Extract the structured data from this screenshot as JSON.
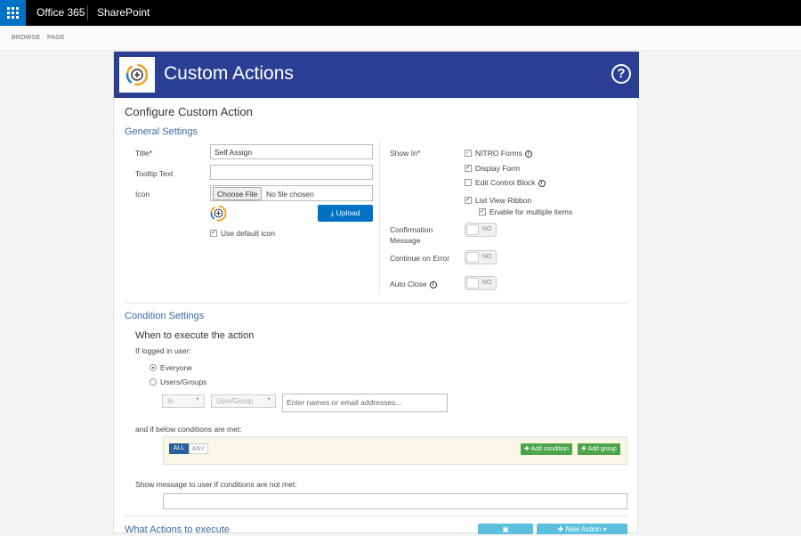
{
  "topbar": {
    "brand": "Office 365",
    "site": "SharePoint"
  },
  "ribbon": {
    "tabs": [
      "BROWSE",
      "PAGE"
    ]
  },
  "header": {
    "title": "Custom Actions",
    "help": "?"
  },
  "configure": {
    "title": "Configure Custom Action"
  },
  "general": {
    "heading": "General Settings",
    "title_label": "Title",
    "req": "*",
    "title_value": "Self Assign",
    "tooltip_label": "Tooltip Text",
    "tooltip_value": "",
    "icon_label": "Icon",
    "choose_file": "Choose File",
    "no_file": "No file chosen",
    "upload": "Upload",
    "use_default": "Use default icon"
  },
  "showin": {
    "label": "Show In",
    "req": "*",
    "options": [
      {
        "label": "NITRO Forms",
        "checked": true,
        "info": true
      },
      {
        "label": "Display Form",
        "checked": true,
        "info": false
      },
      {
        "label": "Edit Control Block",
        "checked": false,
        "info": true
      },
      {
        "label": "List View Ribbon",
        "checked": true,
        "info": false
      },
      {
        "label": "Enable for multiple items",
        "checked": true,
        "info": false
      }
    ]
  },
  "toggles": {
    "confirmation_label": "Confirmation Message",
    "continue_label": "Continue on Error",
    "autoclose_label": "Auto Close",
    "no": "NO"
  },
  "condition": {
    "heading": "Condition Settings",
    "when": "When to execute the action",
    "if_logged": "If logged in user:",
    "everyone": "Everyone",
    "users_groups": "Users/Groups",
    "in_select": "In",
    "usergroup_select": "User/Group",
    "names_placeholder": "Enter names or email addresses...",
    "below_met": "and if below conditions are met:",
    "all": "ALL",
    "any": "ANY",
    "add_condition": "Add condition",
    "add_group": "Add group",
    "show_message": "Show message to user if conditions are not met:"
  },
  "actions": {
    "heading": "What Actions to execute",
    "new_action": "New Action"
  },
  "colors": {
    "header_blue": "#2a3f94",
    "accent": "#0072c6",
    "green": "#4ca54a"
  }
}
